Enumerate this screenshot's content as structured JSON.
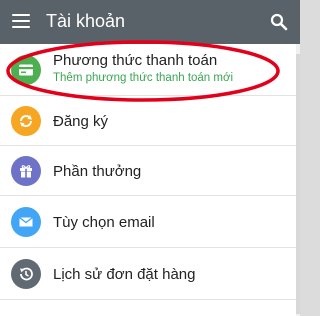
{
  "appbar": {
    "title": "Tài khoản",
    "background": "#5a6269",
    "menu_icon": "hamburger-menu-icon",
    "search_icon": "search-icon"
  },
  "items": [
    {
      "label": "Phương thức thanh toán",
      "sublabel": "Thêm phương thức thanh toán mới",
      "icon": "credit-card-icon",
      "color": "#4caf50"
    },
    {
      "label": "Đăng ký",
      "icon": "refresh-icon",
      "color": "#f6a623"
    },
    {
      "label": "Phần thưởng",
      "icon": "gift-icon",
      "color": "#6e73c8"
    },
    {
      "label": "Tùy chọn email",
      "icon": "email-icon",
      "color": "#42a5f5"
    },
    {
      "label": "Lịch sử đơn đặt hàng",
      "icon": "history-icon",
      "color": "#616a72"
    }
  ],
  "annotation_color": "#e3001b"
}
